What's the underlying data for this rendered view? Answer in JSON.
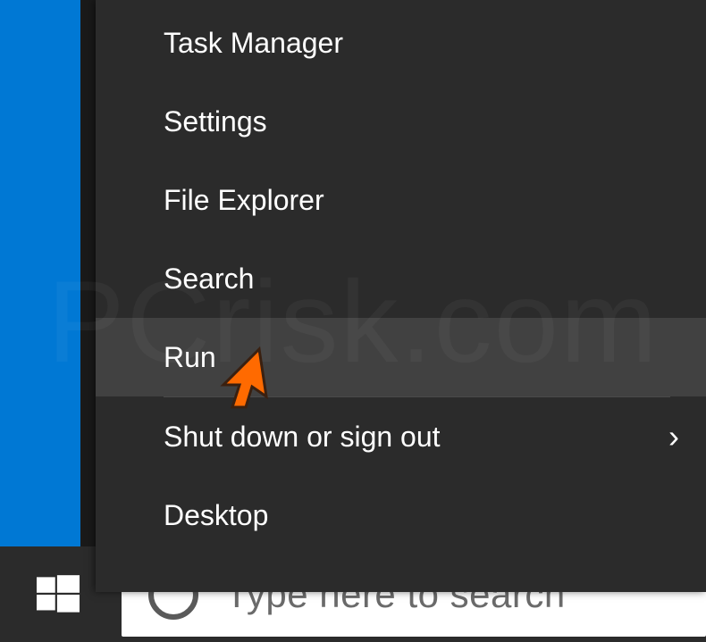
{
  "menu": {
    "items": [
      {
        "label": "Task Manager",
        "hovered": false,
        "hasSubmenu": false
      },
      {
        "label": "Settings",
        "hovered": false,
        "hasSubmenu": false
      },
      {
        "label": "File Explorer",
        "hovered": false,
        "hasSubmenu": false
      },
      {
        "label": "Search",
        "hovered": false,
        "hasSubmenu": false
      },
      {
        "label": "Run",
        "hovered": true,
        "hasSubmenu": false
      }
    ],
    "belowDivider": [
      {
        "label": "Shut down or sign out",
        "hovered": false,
        "hasSubmenu": true
      },
      {
        "label": "Desktop",
        "hovered": false,
        "hasSubmenu": false
      }
    ]
  },
  "taskbar": {
    "search_placeholder": "Type here to search"
  },
  "watermark": "PCrisk.com",
  "cursor": {
    "color": "#ff6a00"
  }
}
